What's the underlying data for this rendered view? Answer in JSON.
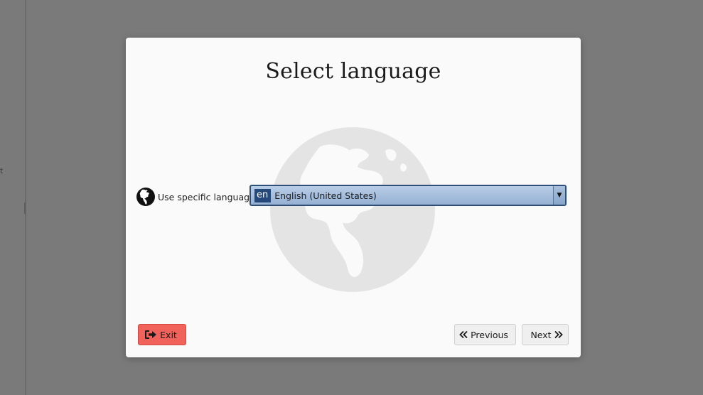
{
  "background": {
    "fragment_text": "t"
  },
  "dialog": {
    "title": "Select language",
    "language": {
      "label": "Use specific language",
      "selected_code": "en",
      "selected_name": "English (United States)",
      "dropdown_arrow": "▼"
    },
    "buttons": {
      "exit": "Exit",
      "previous": "Previous",
      "next": "Next"
    }
  },
  "colors": {
    "overlay": "#7a7a7a",
    "dialog_bg": "#fafafa",
    "exit_button": "#f0625a",
    "select_border": "#2e4f77",
    "select_code_bg": "#254a7a"
  },
  "icons": {
    "watermark": "globe-americas-icon",
    "language": "globe-americas-icon",
    "exit": "sign-out-icon",
    "previous": "double-chevron-left-icon",
    "next": "double-chevron-right-icon"
  }
}
